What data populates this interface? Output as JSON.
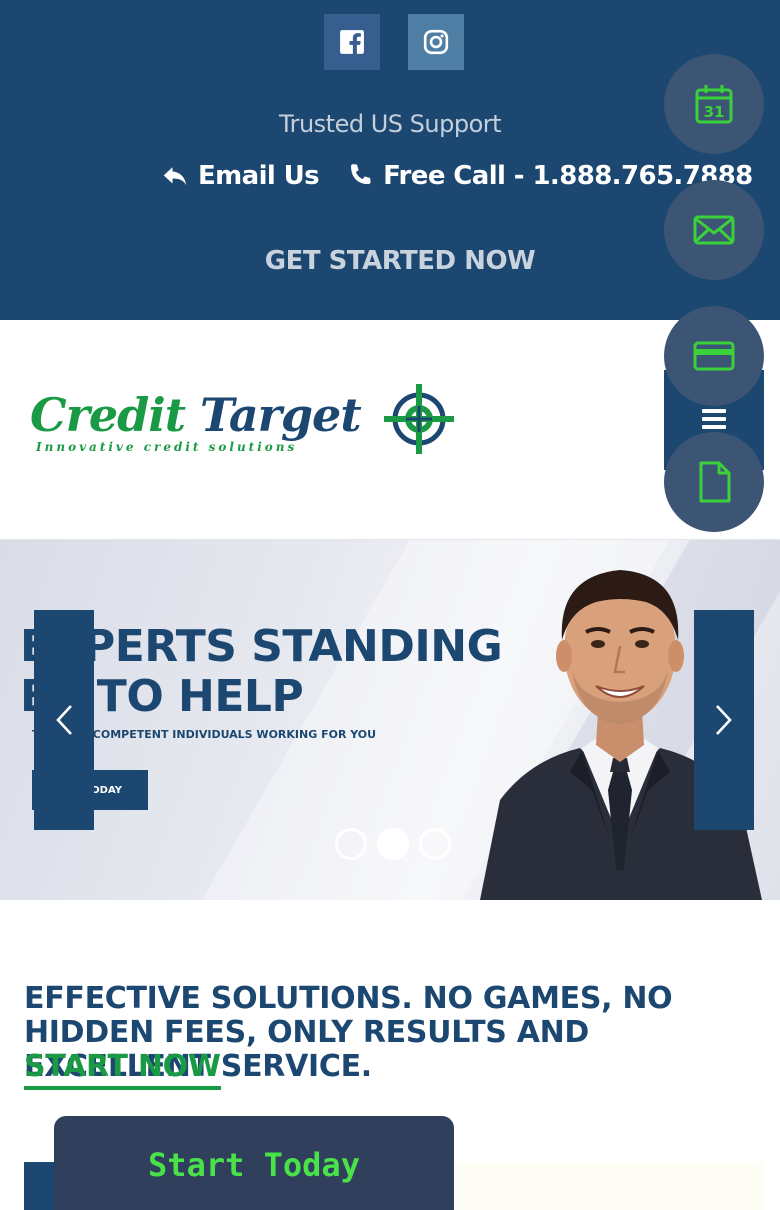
{
  "topbar": {
    "social": [
      {
        "name": "facebook-icon",
        "bg": "#375e8e"
      },
      {
        "name": "instagram-icon",
        "bg": "#4e7ea3"
      }
    ],
    "trusted_text": "Trusted US Support",
    "email_label": "Email Us",
    "call_label": "Free Call - 1.888.765.7888",
    "get_started": "GET STARTED NOW"
  },
  "floating_actions": [
    {
      "icon": "calendar-icon"
    },
    {
      "icon": "mail-icon"
    },
    {
      "icon": "credit-card-icon"
    },
    {
      "icon": "document-icon"
    }
  ],
  "logo": {
    "word1": "Credit ",
    "word2": "Target",
    "tagline": "Innovative credit solutions"
  },
  "hero": {
    "title_line1": "EXPERTS STANDING",
    "title_line2": "BY TO HELP",
    "subtitle": "TRUSTED COMPETENT INDIVIDUALS WORKING FOR YOU",
    "button_label": "START TODAY",
    "slide_count": 3,
    "active_slide": 2
  },
  "main": {
    "headline": "EFFECTIVE SOLUTIONS. NO GAMES, NO HIDDEN FEES, ONLY RESULTS AND EXCELLENT SERVICE.",
    "start_now": "START NOW"
  },
  "widget": {
    "start_today": "Start Today"
  },
  "colors": {
    "navy": "#1c4771",
    "green": "#1a9a44",
    "fab_bg": "#3d5575",
    "widget_bg": "#2f3f5c",
    "widget_text": "#49e249"
  }
}
